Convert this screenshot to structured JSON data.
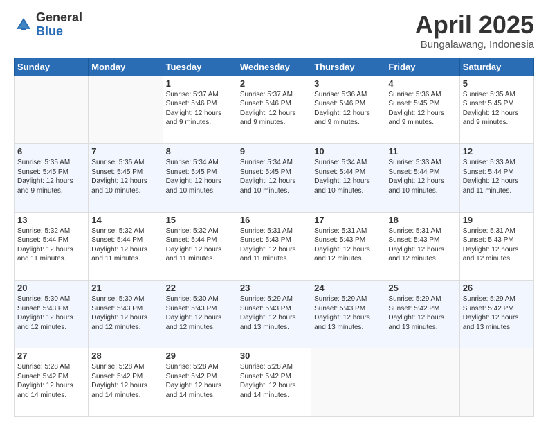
{
  "header": {
    "logo_general": "General",
    "logo_blue": "Blue",
    "month": "April 2025",
    "location": "Bungalawang, Indonesia"
  },
  "weekdays": [
    "Sunday",
    "Monday",
    "Tuesday",
    "Wednesday",
    "Thursday",
    "Friday",
    "Saturday"
  ],
  "weeks": [
    [
      {
        "day": "",
        "lines": [],
        "empty": true
      },
      {
        "day": "",
        "lines": [],
        "empty": true
      },
      {
        "day": "1",
        "lines": [
          "Sunrise: 5:37 AM",
          "Sunset: 5:46 PM",
          "Daylight: 12 hours",
          "and 9 minutes."
        ]
      },
      {
        "day": "2",
        "lines": [
          "Sunrise: 5:37 AM",
          "Sunset: 5:46 PM",
          "Daylight: 12 hours",
          "and 9 minutes."
        ]
      },
      {
        "day": "3",
        "lines": [
          "Sunrise: 5:36 AM",
          "Sunset: 5:46 PM",
          "Daylight: 12 hours",
          "and 9 minutes."
        ]
      },
      {
        "day": "4",
        "lines": [
          "Sunrise: 5:36 AM",
          "Sunset: 5:45 PM",
          "Daylight: 12 hours",
          "and 9 minutes."
        ]
      },
      {
        "day": "5",
        "lines": [
          "Sunrise: 5:35 AM",
          "Sunset: 5:45 PM",
          "Daylight: 12 hours",
          "and 9 minutes."
        ]
      }
    ],
    [
      {
        "day": "6",
        "lines": [
          "Sunrise: 5:35 AM",
          "Sunset: 5:45 PM",
          "Daylight: 12 hours",
          "and 9 minutes."
        ]
      },
      {
        "day": "7",
        "lines": [
          "Sunrise: 5:35 AM",
          "Sunset: 5:45 PM",
          "Daylight: 12 hours",
          "and 10 minutes."
        ]
      },
      {
        "day": "8",
        "lines": [
          "Sunrise: 5:34 AM",
          "Sunset: 5:45 PM",
          "Daylight: 12 hours",
          "and 10 minutes."
        ]
      },
      {
        "day": "9",
        "lines": [
          "Sunrise: 5:34 AM",
          "Sunset: 5:45 PM",
          "Daylight: 12 hours",
          "and 10 minutes."
        ]
      },
      {
        "day": "10",
        "lines": [
          "Sunrise: 5:34 AM",
          "Sunset: 5:44 PM",
          "Daylight: 12 hours",
          "and 10 minutes."
        ]
      },
      {
        "day": "11",
        "lines": [
          "Sunrise: 5:33 AM",
          "Sunset: 5:44 PM",
          "Daylight: 12 hours",
          "and 10 minutes."
        ]
      },
      {
        "day": "12",
        "lines": [
          "Sunrise: 5:33 AM",
          "Sunset: 5:44 PM",
          "Daylight: 12 hours",
          "and 11 minutes."
        ]
      }
    ],
    [
      {
        "day": "13",
        "lines": [
          "Sunrise: 5:32 AM",
          "Sunset: 5:44 PM",
          "Daylight: 12 hours",
          "and 11 minutes."
        ]
      },
      {
        "day": "14",
        "lines": [
          "Sunrise: 5:32 AM",
          "Sunset: 5:44 PM",
          "Daylight: 12 hours",
          "and 11 minutes."
        ]
      },
      {
        "day": "15",
        "lines": [
          "Sunrise: 5:32 AM",
          "Sunset: 5:44 PM",
          "Daylight: 12 hours",
          "and 11 minutes."
        ]
      },
      {
        "day": "16",
        "lines": [
          "Sunrise: 5:31 AM",
          "Sunset: 5:43 PM",
          "Daylight: 12 hours",
          "and 11 minutes."
        ]
      },
      {
        "day": "17",
        "lines": [
          "Sunrise: 5:31 AM",
          "Sunset: 5:43 PM",
          "Daylight: 12 hours",
          "and 12 minutes."
        ]
      },
      {
        "day": "18",
        "lines": [
          "Sunrise: 5:31 AM",
          "Sunset: 5:43 PM",
          "Daylight: 12 hours",
          "and 12 minutes."
        ]
      },
      {
        "day": "19",
        "lines": [
          "Sunrise: 5:31 AM",
          "Sunset: 5:43 PM",
          "Daylight: 12 hours",
          "and 12 minutes."
        ]
      }
    ],
    [
      {
        "day": "20",
        "lines": [
          "Sunrise: 5:30 AM",
          "Sunset: 5:43 PM",
          "Daylight: 12 hours",
          "and 12 minutes."
        ]
      },
      {
        "day": "21",
        "lines": [
          "Sunrise: 5:30 AM",
          "Sunset: 5:43 PM",
          "Daylight: 12 hours",
          "and 12 minutes."
        ]
      },
      {
        "day": "22",
        "lines": [
          "Sunrise: 5:30 AM",
          "Sunset: 5:43 PM",
          "Daylight: 12 hours",
          "and 12 minutes."
        ]
      },
      {
        "day": "23",
        "lines": [
          "Sunrise: 5:29 AM",
          "Sunset: 5:43 PM",
          "Daylight: 12 hours",
          "and 13 minutes."
        ]
      },
      {
        "day": "24",
        "lines": [
          "Sunrise: 5:29 AM",
          "Sunset: 5:43 PM",
          "Daylight: 12 hours",
          "and 13 minutes."
        ]
      },
      {
        "day": "25",
        "lines": [
          "Sunrise: 5:29 AM",
          "Sunset: 5:42 PM",
          "Daylight: 12 hours",
          "and 13 minutes."
        ]
      },
      {
        "day": "26",
        "lines": [
          "Sunrise: 5:29 AM",
          "Sunset: 5:42 PM",
          "Daylight: 12 hours",
          "and 13 minutes."
        ]
      }
    ],
    [
      {
        "day": "27",
        "lines": [
          "Sunrise: 5:28 AM",
          "Sunset: 5:42 PM",
          "Daylight: 12 hours",
          "and 14 minutes."
        ]
      },
      {
        "day": "28",
        "lines": [
          "Sunrise: 5:28 AM",
          "Sunset: 5:42 PM",
          "Daylight: 12 hours",
          "and 14 minutes."
        ]
      },
      {
        "day": "29",
        "lines": [
          "Sunrise: 5:28 AM",
          "Sunset: 5:42 PM",
          "Daylight: 12 hours",
          "and 14 minutes."
        ]
      },
      {
        "day": "30",
        "lines": [
          "Sunrise: 5:28 AM",
          "Sunset: 5:42 PM",
          "Daylight: 12 hours",
          "and 14 minutes."
        ]
      },
      {
        "day": "",
        "lines": [],
        "empty": true
      },
      {
        "day": "",
        "lines": [],
        "empty": true
      },
      {
        "day": "",
        "lines": [],
        "empty": true
      }
    ]
  ]
}
